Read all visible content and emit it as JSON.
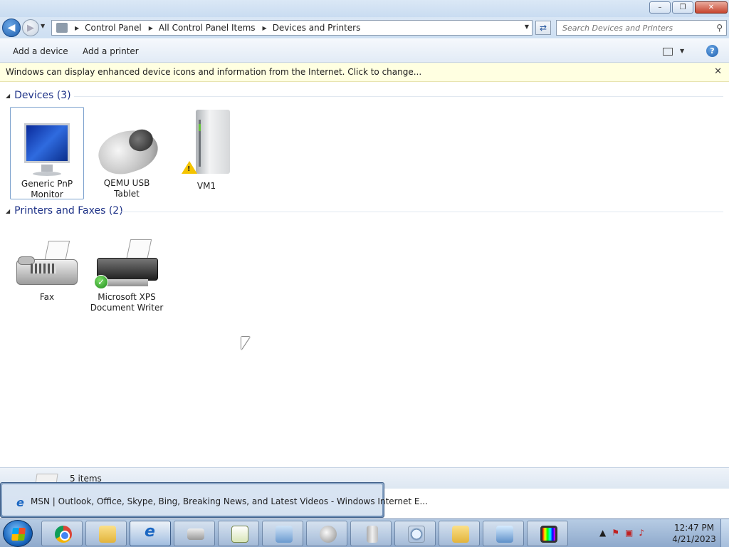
{
  "window": {
    "controls": {
      "minimize": "–",
      "restore": "❐",
      "close": "✕"
    }
  },
  "navbar": {
    "breadcrumb": [
      "Control Panel",
      "All Control Panel Items",
      "Devices and Printers"
    ],
    "search_placeholder": "Search Devices and Printers"
  },
  "commandbar": {
    "add_device": "Add a device",
    "add_printer": "Add a printer"
  },
  "infobar": {
    "text": "Windows can display enhanced device icons and information from the Internet. Click to change..."
  },
  "groups": [
    {
      "title": "Devices (3)",
      "items": [
        {
          "label": "Generic PnP Monitor",
          "icon": "monitor-icon",
          "selected": true
        },
        {
          "label": "QEMU USB Tablet",
          "icon": "mouse-icon"
        },
        {
          "label": "VM1",
          "icon": "drive-icon",
          "badge": "warning"
        }
      ]
    },
    {
      "title": "Printers and Faxes (2)",
      "items": [
        {
          "label": "Fax",
          "icon": "fax-icon"
        },
        {
          "label": "Microsoft XPS Document Writer",
          "icon": "printer-icon",
          "badge": "default-check"
        }
      ]
    }
  ],
  "details": {
    "count_text": "5 items"
  },
  "taskbar_tooltip": {
    "text": "MSN | Outlook, Office, Skype, Bing, Breaking News, and Latest Videos - Windows Internet E..."
  },
  "taskbar": {
    "apps": [
      "chrome",
      "file-explorer",
      "internet-explorer",
      "scanner",
      "notepad",
      "control-panel",
      "mouse",
      "server",
      "search",
      "folder",
      "remote-desktop",
      "display"
    ],
    "clock_time": "12:47 PM",
    "clock_date": "4/21/2023"
  }
}
